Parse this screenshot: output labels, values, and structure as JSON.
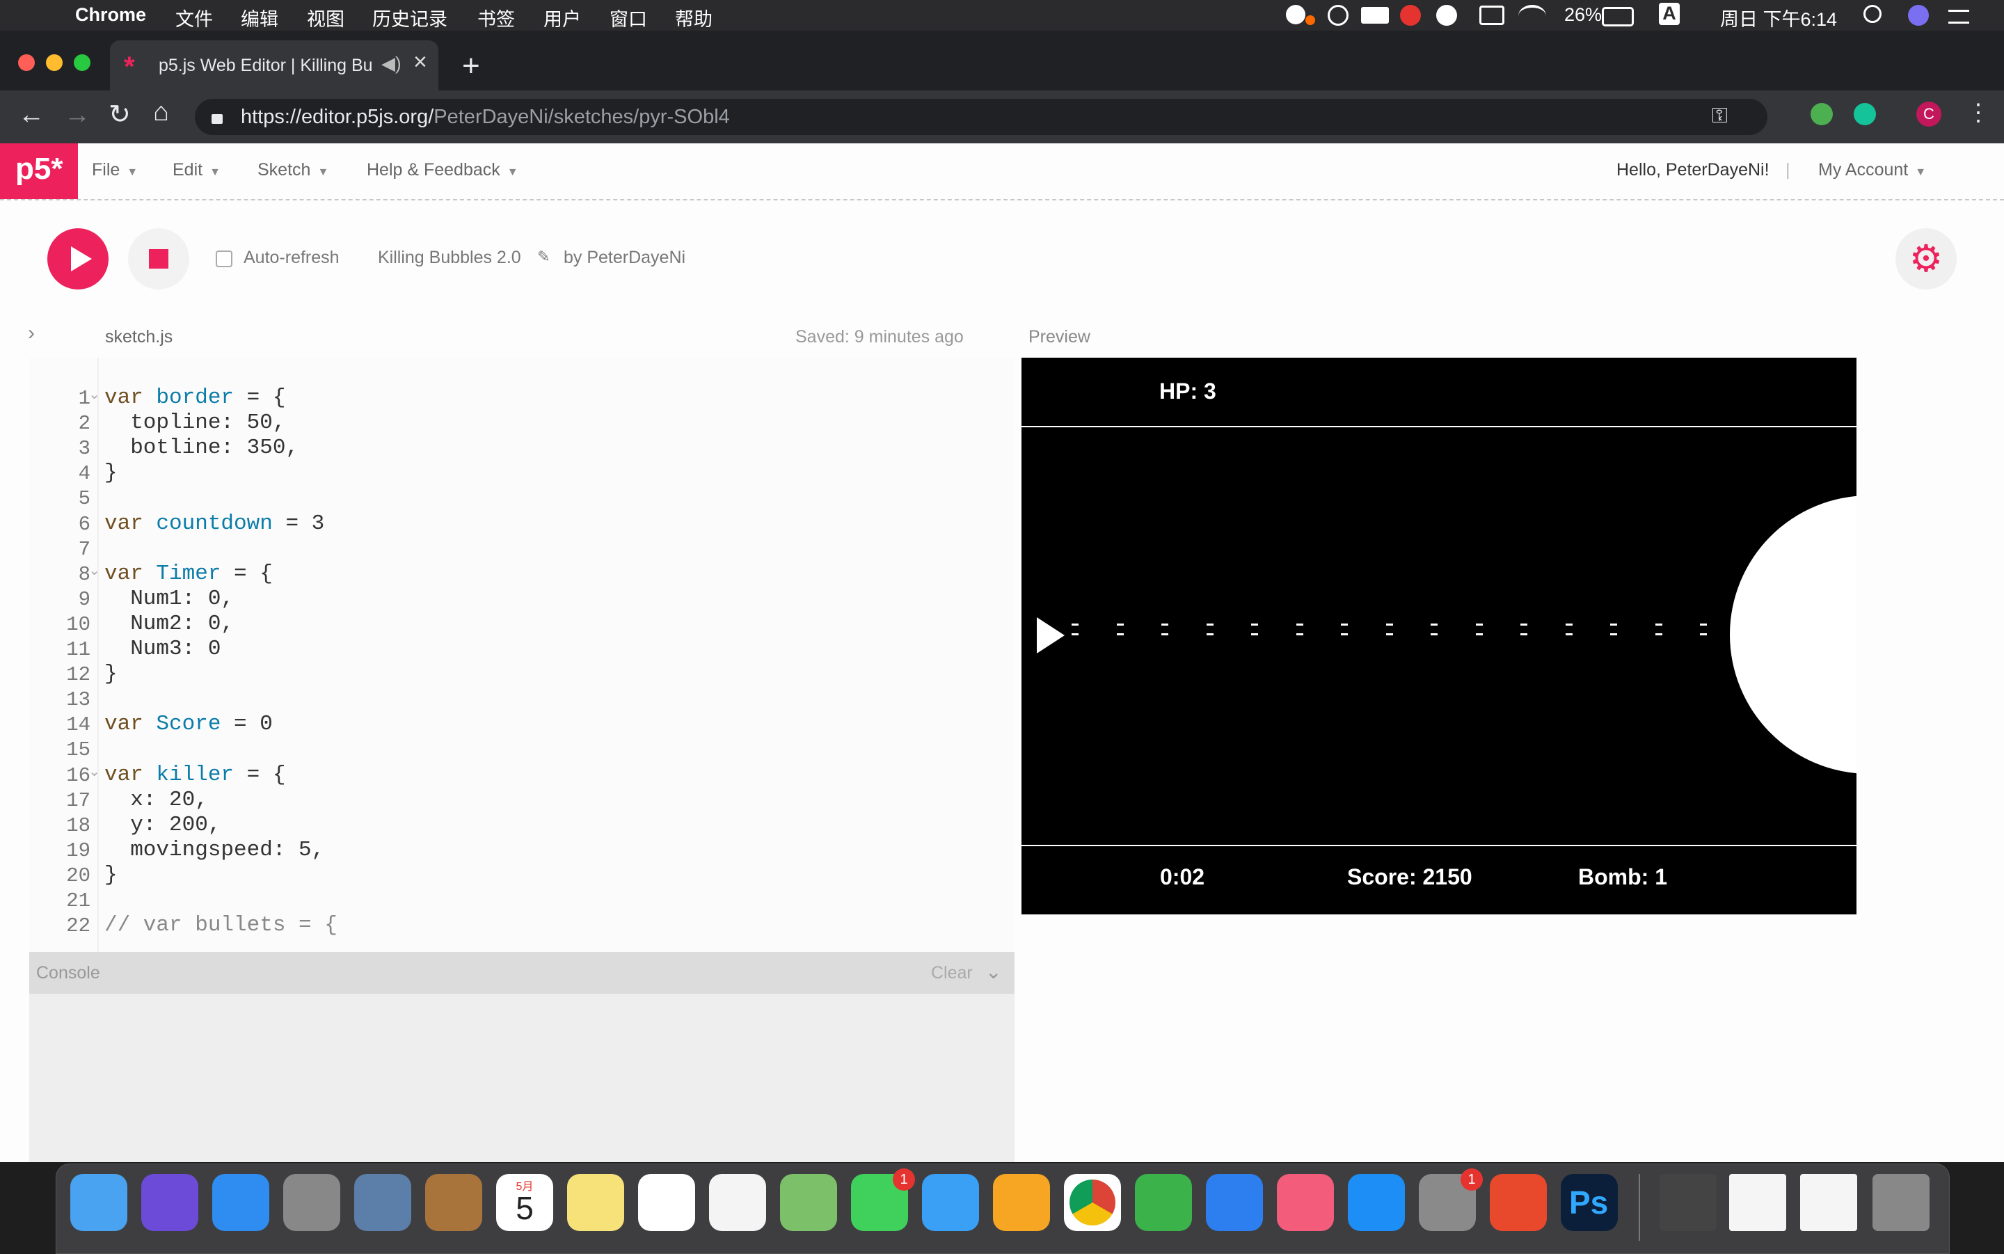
{
  "menubar": {
    "app_name": "Chrome",
    "menus": [
      "文件",
      "编辑",
      "视图",
      "历史记录",
      "书签",
      "用户",
      "窗口",
      "帮助"
    ],
    "battery": "26%",
    "clock": "周日 下午6:14",
    "input_method": "A"
  },
  "browser": {
    "tab_title": "p5.js Web Editor | Killing Bu",
    "url_host": "https://editor.p5js.org/",
    "url_path": "PeterDayeNi/sketches/pyr-SObl4",
    "profile_initial": "C"
  },
  "p5": {
    "logo": "p5*",
    "menu": [
      "File",
      "Edit",
      "Sketch",
      "Help & Feedback"
    ],
    "greeting": "Hello, PeterDayeNi!",
    "separator": "|",
    "account": "My Account",
    "auto_refresh": "Auto-refresh",
    "sketch_name": "Killing Bubbles 2.0",
    "author": "by PeterDayeNi",
    "file_name": "sketch.js",
    "saved": "Saved: 9 minutes ago",
    "preview": "Preview",
    "console": "Console",
    "clear": "Clear"
  },
  "code": {
    "lines": [
      {
        "n": "1",
        "kw": "var",
        "id": "border",
        "rest": " = {",
        "fold": true
      },
      {
        "n": "2",
        "text": "  topline: 50,"
      },
      {
        "n": "3",
        "text": "  botline: 350,"
      },
      {
        "n": "4",
        "text": "}"
      },
      {
        "n": "5",
        "text": ""
      },
      {
        "n": "6",
        "kw": "var",
        "id": "countdown",
        "rest": " = 3"
      },
      {
        "n": "7",
        "text": ""
      },
      {
        "n": "8",
        "kw": "var",
        "id": "Timer",
        "rest": " = {",
        "fold": true
      },
      {
        "n": "9",
        "text": "  Num1: 0,"
      },
      {
        "n": "10",
        "text": "  Num2: 0,"
      },
      {
        "n": "11",
        "text": "  Num3: 0"
      },
      {
        "n": "12",
        "text": "}"
      },
      {
        "n": "13",
        "text": ""
      },
      {
        "n": "14",
        "kw": "var",
        "id": "Score",
        "rest": " = 0"
      },
      {
        "n": "15",
        "text": ""
      },
      {
        "n": "16",
        "kw": "var",
        "id": "killer",
        "rest": " = {",
        "fold": true
      },
      {
        "n": "17",
        "text": "  x: 20,"
      },
      {
        "n": "18",
        "text": "  y: 200,"
      },
      {
        "n": "19",
        "text": "  movingspeed: 5,"
      },
      {
        "n": "20",
        "text": "}"
      },
      {
        "n": "21",
        "text": ""
      },
      {
        "n": "22",
        "comment": "// var bullets = {"
      }
    ]
  },
  "game": {
    "hp": "HP: 3",
    "time": "0:02",
    "score": "Score: 2150",
    "bomb": "Bomb: 1"
  },
  "dock": {
    "apps": [
      "Finder",
      "Siri",
      "Safari",
      "Launchpad",
      "Preview",
      "Contacts",
      "Calendar",
      "Notes",
      "Reminders",
      "Photos",
      "Maps",
      "FaceTime",
      "Messages",
      "Pages",
      "Chrome",
      "Numbers",
      "Keynote",
      "iTunes",
      "App Store",
      "System Preferences",
      "NetEase Music",
      "Photoshop"
    ],
    "calendar_month": "5月",
    "calendar_day": "5",
    "facetime_badge": "1",
    "prefs_badge": "1",
    "ps_label": "Ps"
  },
  "colors": {
    "accent": "#ed225d"
  }
}
